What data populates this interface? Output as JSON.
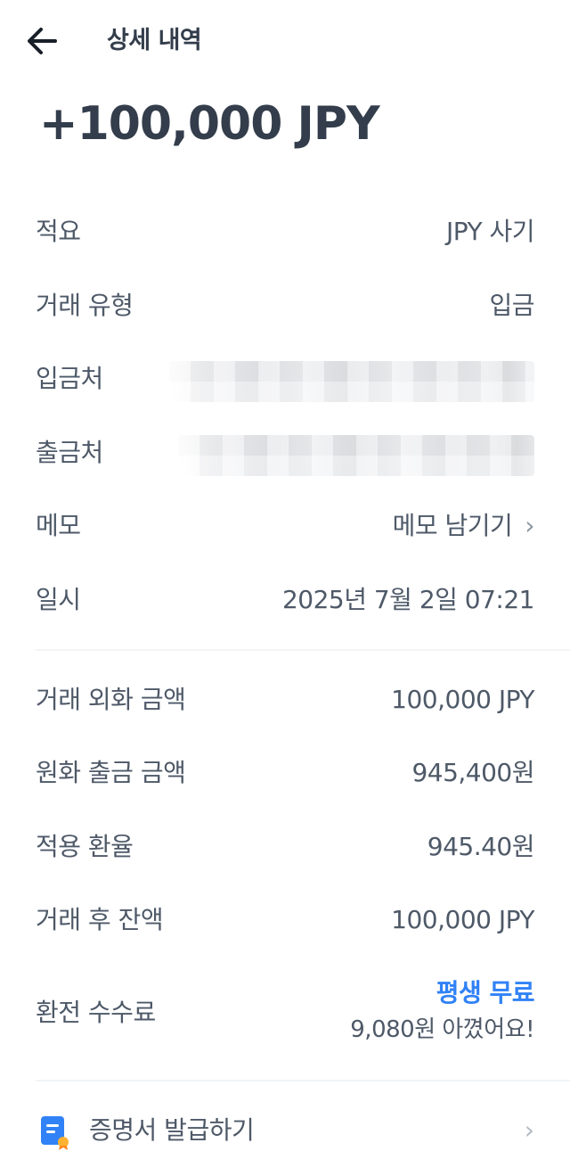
{
  "header": {
    "title": "상세 내역"
  },
  "amount": "+100,000 JPY",
  "details": {
    "summary": {
      "label": "적요",
      "value": "JPY 사기"
    },
    "type": {
      "label": "거래 유형",
      "value": "입금"
    },
    "deposit_to": {
      "label": "입금처"
    },
    "withdraw_from": {
      "label": "출금처"
    },
    "memo": {
      "label": "메모",
      "action": "메모 남기기"
    },
    "datetime": {
      "label": "일시",
      "value": "2025년 7월 2일 07:21"
    }
  },
  "exchange": {
    "foreign_amount": {
      "label": "거래 외화 금액",
      "value": "100,000 JPY"
    },
    "krw_amount": {
      "label": "원화 출금 금액",
      "value": "945,400원"
    },
    "rate": {
      "label": "적용 환율",
      "value": "945.40원"
    },
    "balance": {
      "label": "거래 후 잔액",
      "value": "100,000 JPY"
    },
    "fee": {
      "label": "환전 수수료",
      "highlight": "평생 무료",
      "saved": "9,080원 아꼈어요!"
    }
  },
  "certificate": {
    "label": "증명서 발급하기"
  },
  "colors": {
    "accent": "#3182f6",
    "text": "#4e5968",
    "heading": "#333d4b",
    "divider": "#f2f4f6"
  },
  "icons": {
    "back": "arrow-left-icon",
    "chevron": "chevron-right-icon",
    "certificate": "document-badge-icon"
  }
}
